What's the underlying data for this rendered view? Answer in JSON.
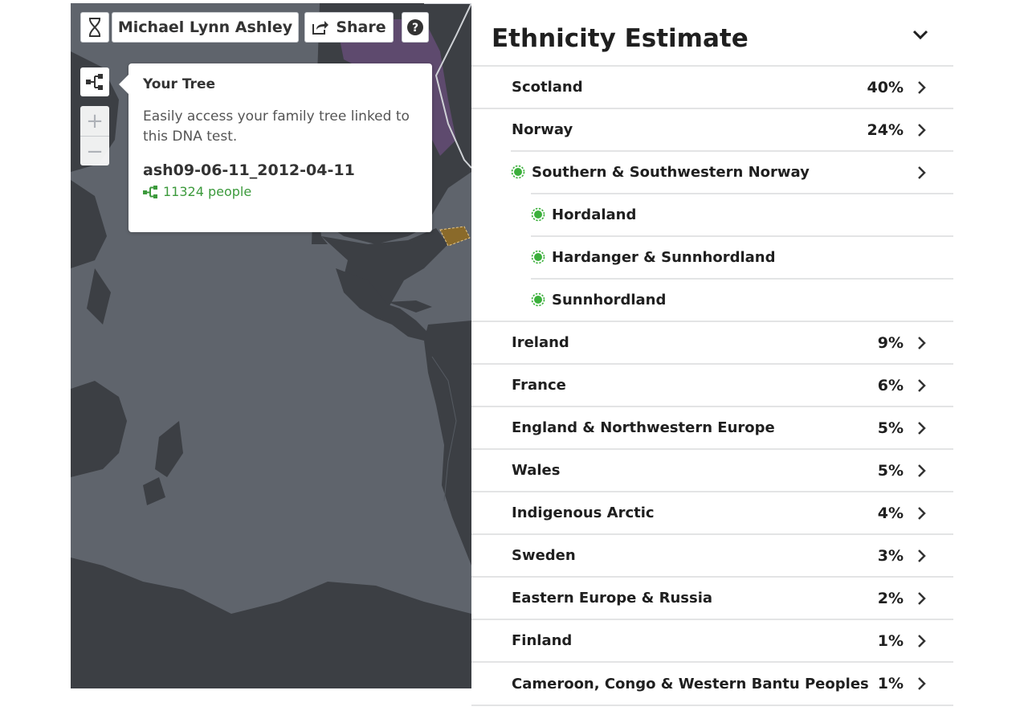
{
  "toolbar": {
    "profile_name": "Michael Lynn Ashley",
    "share_label": "Share",
    "dna_icon": "dna-icon",
    "help_icon": "help-icon"
  },
  "map": {
    "zoom_in_label": "+",
    "zoom_out_label": "−",
    "colors": {
      "ocean": "#5f646c",
      "land": "#3c3f44",
      "region_purple": "#5e4a6e",
      "highlight": "#8a6a2a"
    }
  },
  "popover": {
    "title": "Your Tree",
    "description": "Easily access your family tree linked to this DNA test.",
    "tree_name": "ash09-06-11_2012-04-11",
    "people": "11324 people"
  },
  "panel": {
    "title": "Ethnicity Estimate",
    "regions": [
      {
        "name": "Scotland",
        "percent": "40%"
      },
      {
        "name": "Norway",
        "percent": "24%"
      },
      {
        "name": "Southern & Southwestern Norway",
        "level": 1
      },
      {
        "name": "Hordaland",
        "level": 2
      },
      {
        "name": "Hardanger & Sunnhordland",
        "level": 2
      },
      {
        "name": "Sunnhordland",
        "level": 2
      },
      {
        "name": "Ireland",
        "percent": "9%"
      },
      {
        "name": "France",
        "percent": "6%"
      },
      {
        "name": "England & Northwestern Europe",
        "percent": "5%"
      },
      {
        "name": "Wales",
        "percent": "5%"
      },
      {
        "name": "Indigenous Arctic",
        "percent": "4%"
      },
      {
        "name": "Sweden",
        "percent": "3%"
      },
      {
        "name": "Eastern Europe & Russia",
        "percent": "2%"
      },
      {
        "name": "Finland",
        "percent": "1%"
      },
      {
        "name": "Cameroon, Congo & Western Bantu Peoples",
        "percent": "1%"
      }
    ],
    "accent_green": "#3cb03c"
  }
}
